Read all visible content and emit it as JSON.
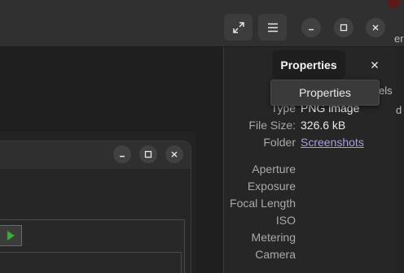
{
  "header": {
    "buttons": [
      {
        "name": "fullscreen",
        "icon": "fullscreen-icon"
      },
      {
        "name": "main-menu",
        "icon": "hamburger-menu-icon"
      }
    ],
    "window_controls": [
      "minimize",
      "maximize",
      "close"
    ]
  },
  "properties_panel": {
    "title": "Properties",
    "close_icon": "close-icon",
    "tooltip": "Properties",
    "rows": [
      {
        "label": "Type",
        "value": "PNG image"
      },
      {
        "label": "File Size:",
        "value": "326.6 kB"
      },
      {
        "label": "Folder",
        "value": "Screenshots",
        "is_link": true
      },
      {
        "label": "Aperture",
        "value": ""
      },
      {
        "label": "Exposure",
        "value": ""
      },
      {
        "label": "Focal Length",
        "value": ""
      },
      {
        "label": "ISO",
        "value": ""
      },
      {
        "label": "Metering",
        "value": ""
      },
      {
        "label": "Camera",
        "value": ""
      }
    ],
    "peek_text": {
      "behind_tooltip": "els",
      "edge_chars": [
        "ere",
        "d"
      ]
    }
  },
  "inner_window": {
    "window_controls": [
      "minimize",
      "maximize",
      "close"
    ],
    "play_icon": "play-icon"
  },
  "colors": {
    "accent_link": "#aa9ce6",
    "play_green": "#3fae3f"
  }
}
